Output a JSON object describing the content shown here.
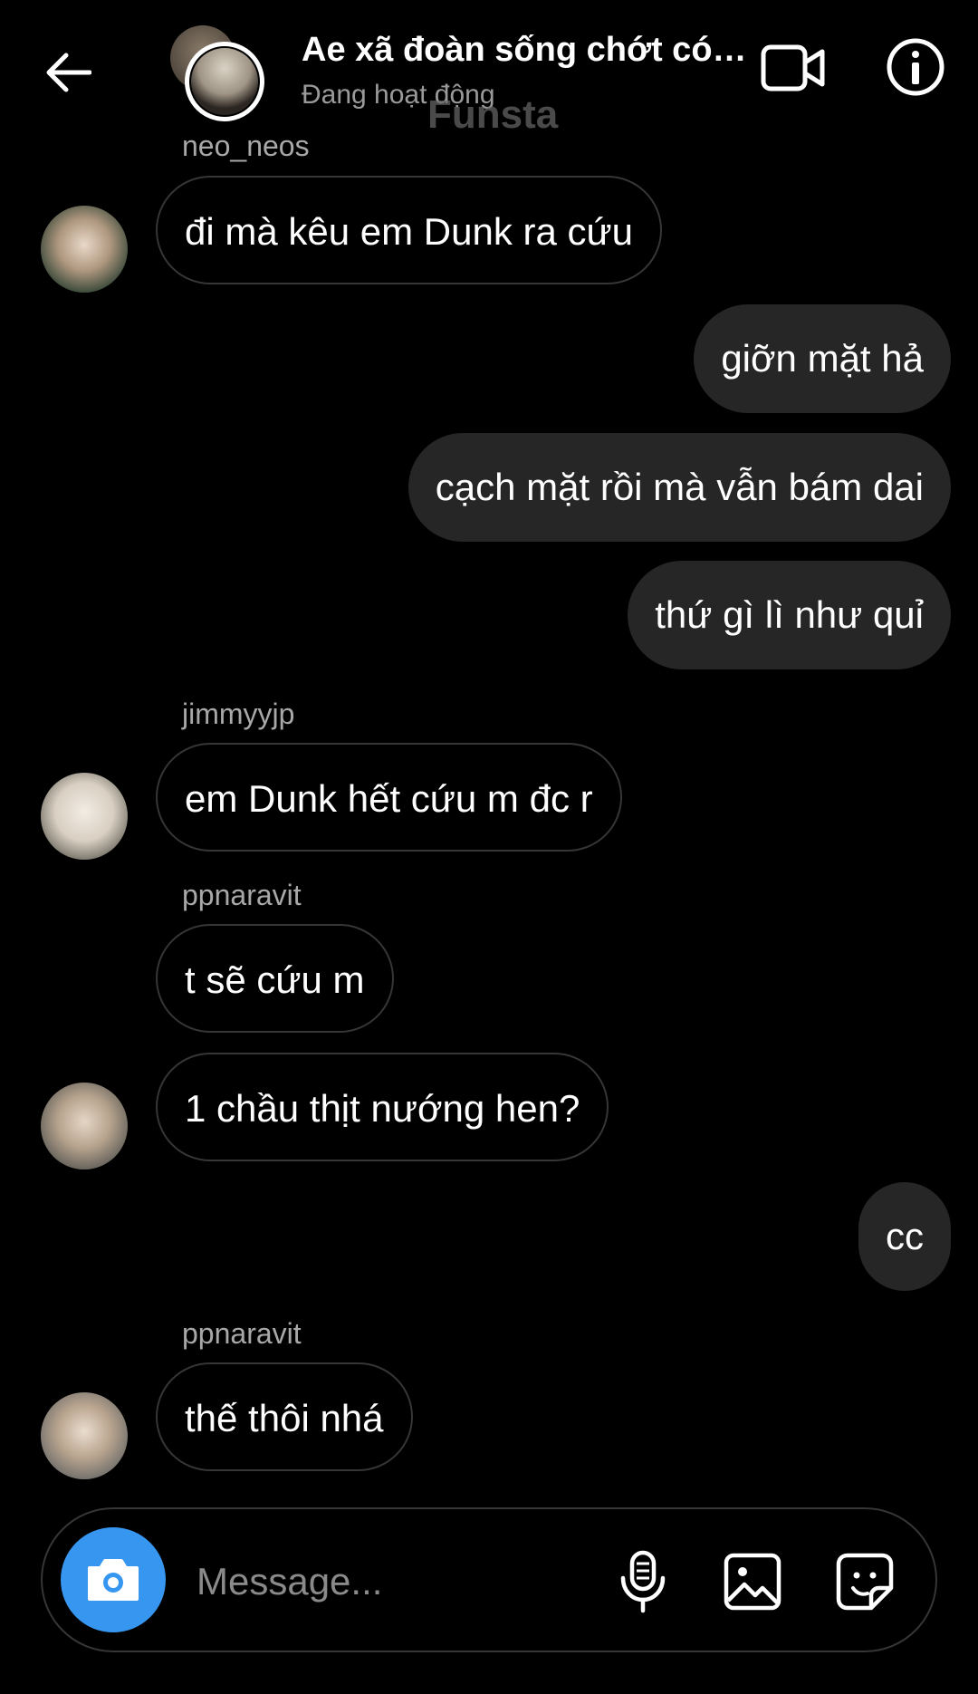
{
  "header": {
    "title": "Ae xã đoàn sống chớt có n...",
    "status": "Đang hoạt động",
    "watermark": "Funsta",
    "icons": {
      "back": "back-arrow-icon",
      "video": "video-call-icon",
      "info": "info-icon"
    }
  },
  "messages": [
    {
      "sender": "neo_neos",
      "text": "đi mà kêu em Dunk ra cứu",
      "direction": "in"
    },
    {
      "text": "giỡn mặt hả",
      "direction": "out"
    },
    {
      "text": "cạch mặt rồi mà vẫn bám dai",
      "direction": "out"
    },
    {
      "text": "thứ gì lì như quỉ",
      "direction": "out"
    },
    {
      "sender": "jimmyyjp",
      "text": "em Dunk hết cứu m đc r",
      "direction": "in"
    },
    {
      "sender": "ppnaravit",
      "text": "t sẽ cứu m",
      "direction": "in"
    },
    {
      "text": "1 chầu thịt nướng hen?",
      "direction": "in"
    },
    {
      "text": "cc",
      "direction": "out"
    },
    {
      "sender": "ppnaravit",
      "text": "thế thôi nhá",
      "direction": "in"
    }
  ],
  "composer": {
    "placeholder": "Message...",
    "icons": {
      "camera": "camera-icon",
      "mic": "microphone-icon",
      "gallery": "image-icon",
      "sticker": "sticker-icon"
    }
  },
  "colors": {
    "background": "#000000",
    "outgoing_bubble": "#262626",
    "accent": "#3797f0",
    "secondary_text": "#a8a8a8"
  }
}
